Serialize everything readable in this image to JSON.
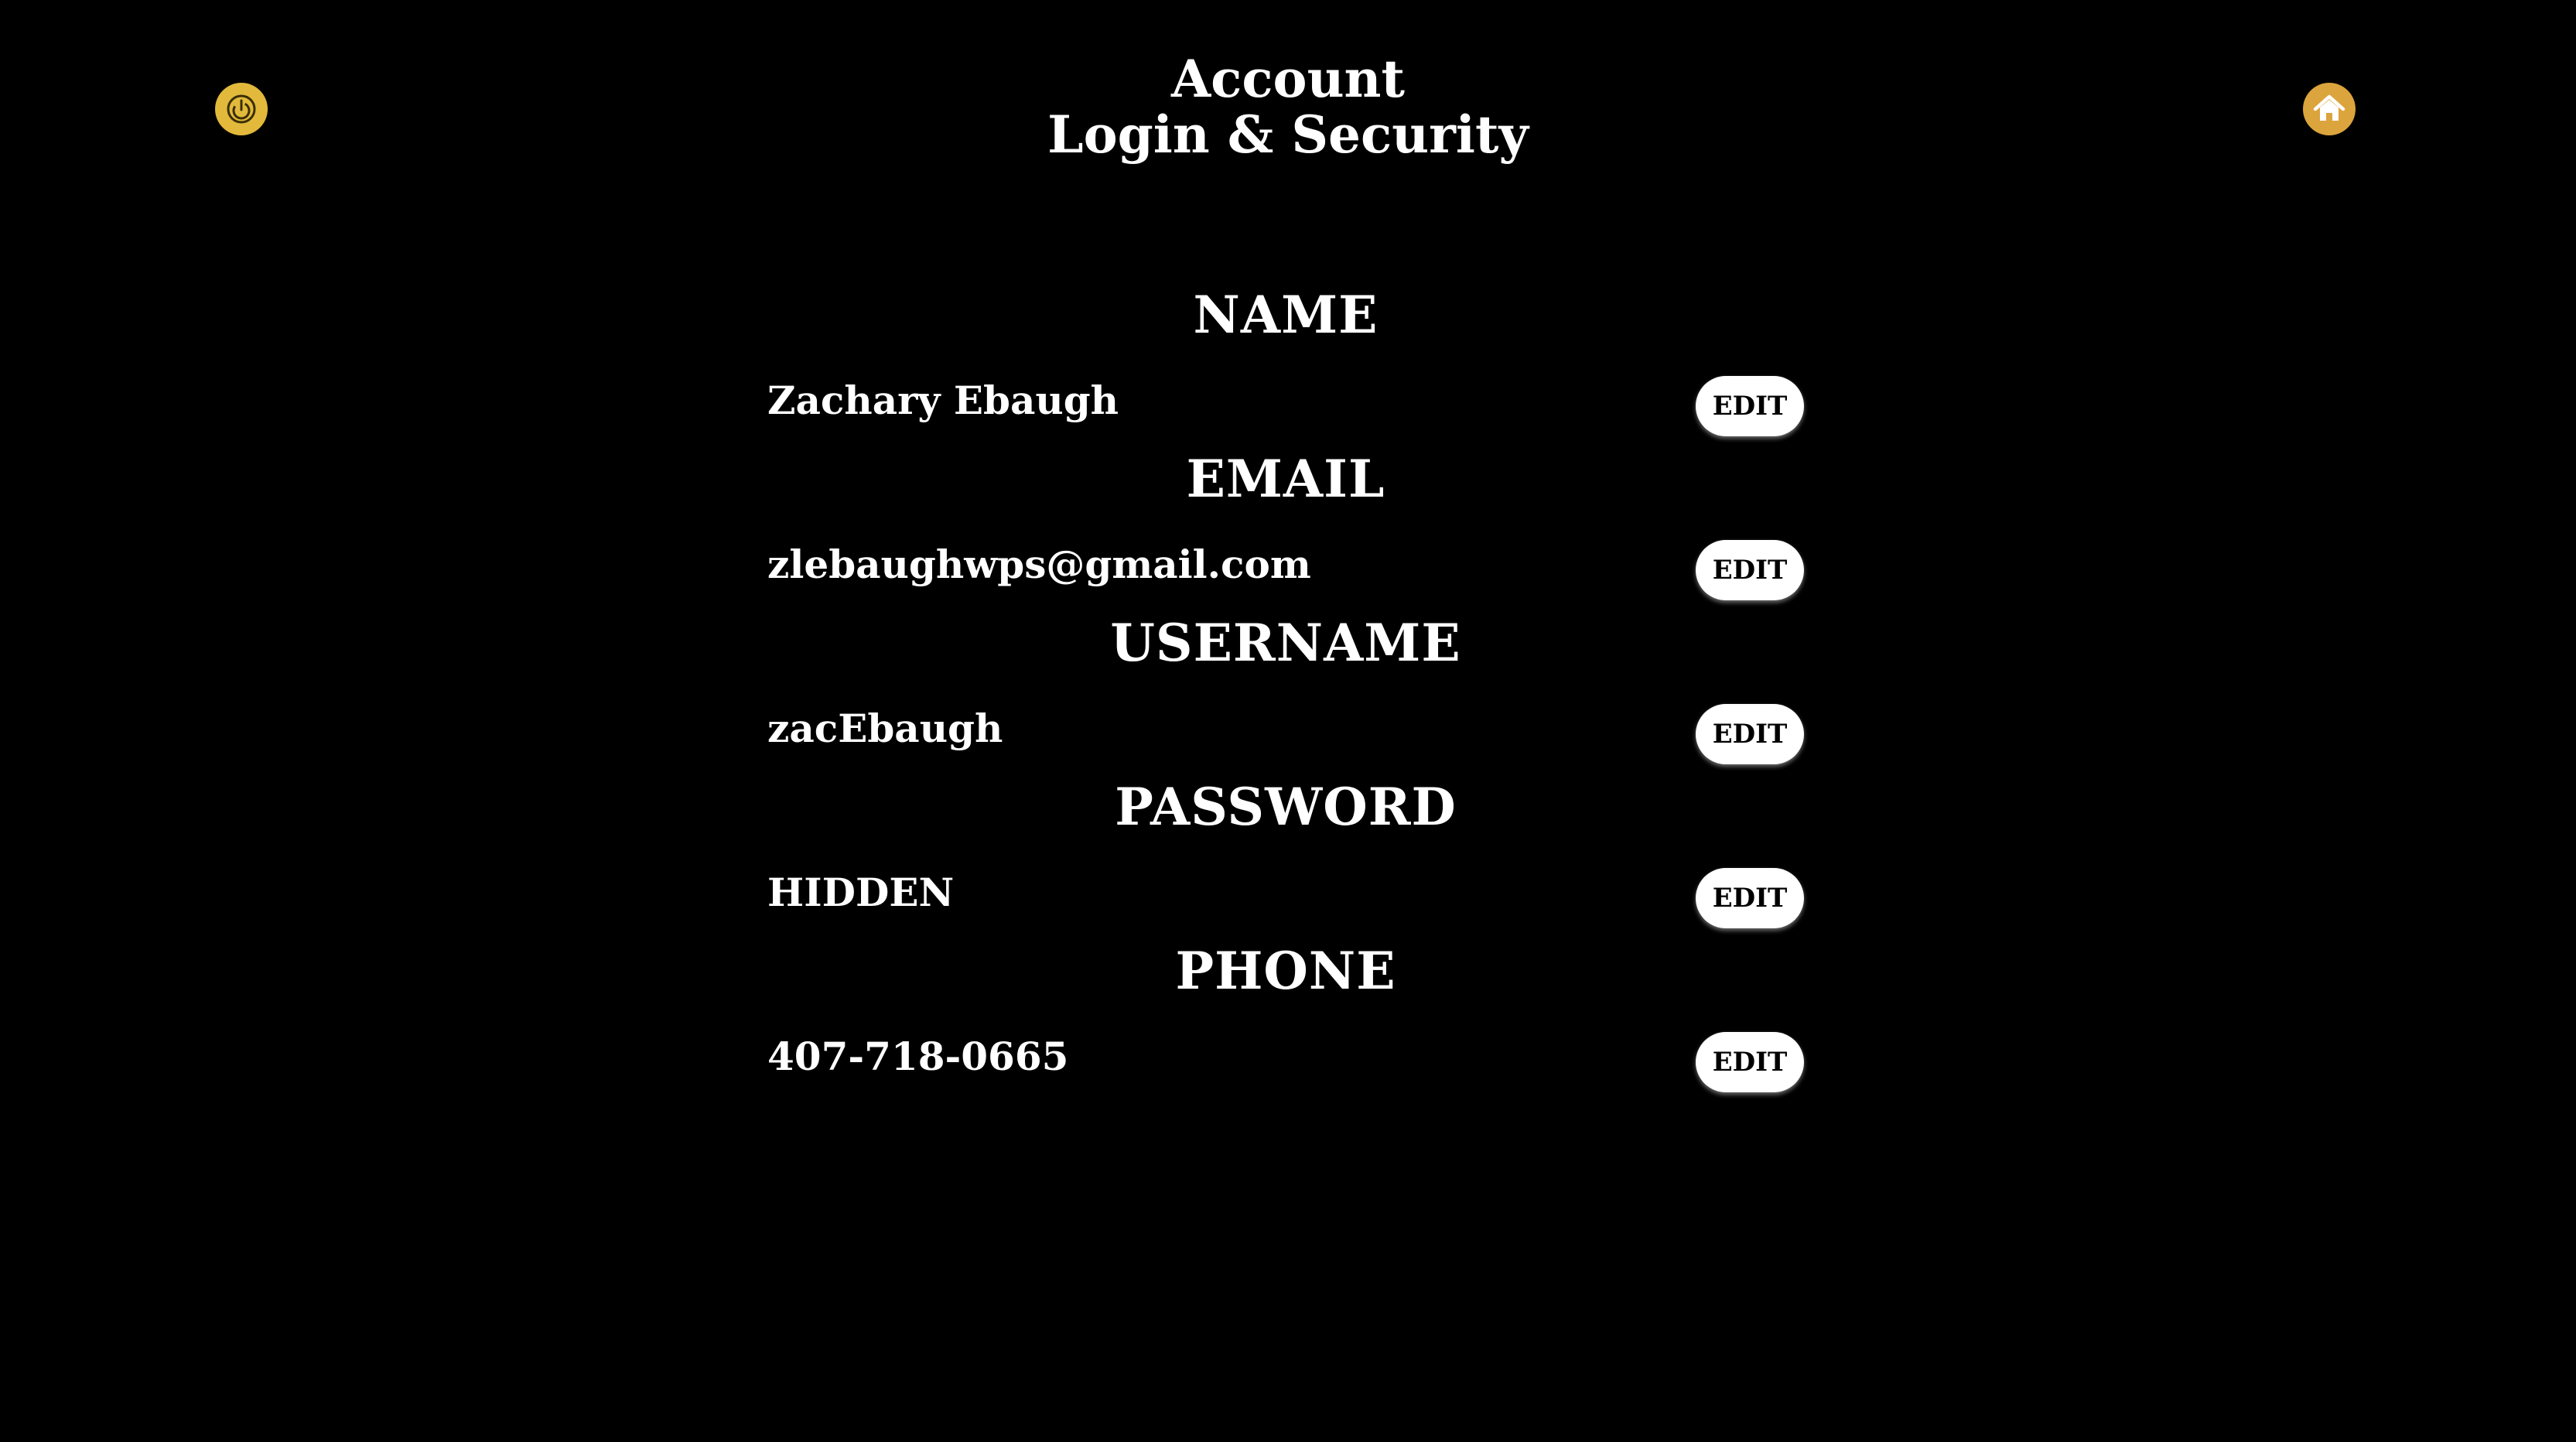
{
  "header": {
    "title_line1": "Account",
    "title_line2": "Login & Security",
    "power_icon": "power-icon",
    "home_icon": "home-icon"
  },
  "colors": {
    "background": "#000000",
    "text": "#ffffff",
    "power_button": "#e2b93b",
    "home_button": "#dba43c",
    "edit_button_bg": "#ffffff",
    "edit_button_text": "#000000"
  },
  "sections": [
    {
      "heading": "NAME",
      "value": "Zachary Ebaugh",
      "edit_label": "EDIT"
    },
    {
      "heading": "EMAIL",
      "value": "zlebaughwps@gmail.com",
      "edit_label": "EDIT"
    },
    {
      "heading": "USERNAME",
      "value": "zacEbaugh",
      "edit_label": "EDIT"
    },
    {
      "heading": "PASSWORD",
      "value": "HIDDEN",
      "edit_label": "EDIT"
    },
    {
      "heading": "PHONE",
      "value": "407-718-0665",
      "edit_label": "EDIT"
    }
  ]
}
